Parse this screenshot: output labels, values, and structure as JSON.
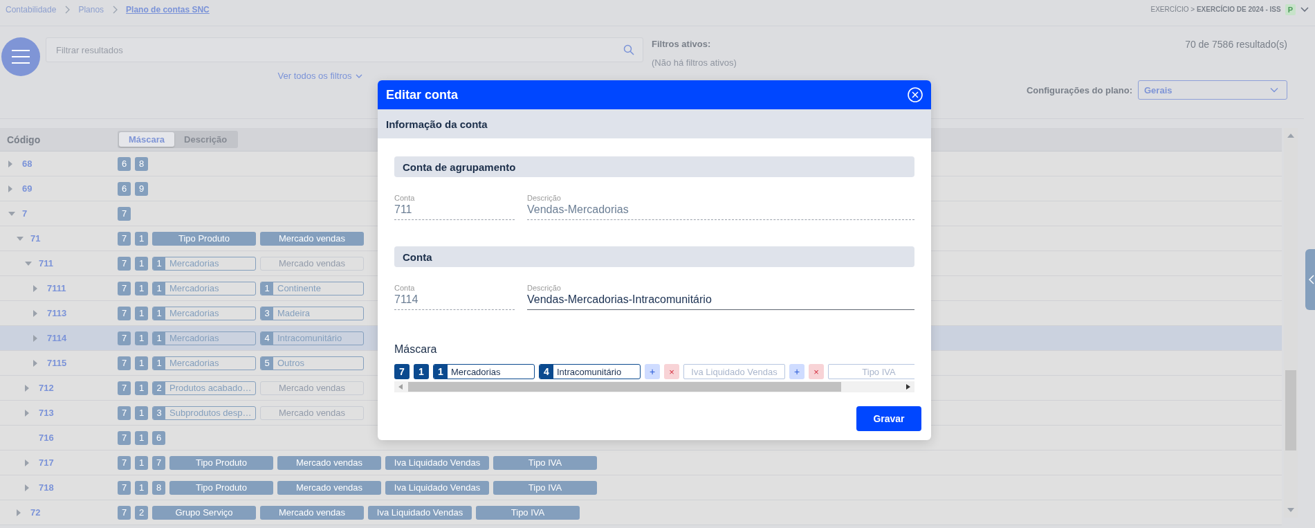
{
  "breadcrumbs": [
    {
      "label": "Contabilidade",
      "current": false
    },
    {
      "label": "Planos",
      "current": false
    },
    {
      "label": "Plano de contas SNC",
      "current": true
    }
  ],
  "exercise": {
    "text": "EXERCÍCIO > **EXERCÍCIO DE 2024 - ISS**",
    "badge": "P"
  },
  "filter": {
    "placeholder": "Filtrar resultados",
    "more_link": "Ver todos os filtros"
  },
  "active_filters": {
    "title": "Filtros ativos:",
    "empty_text": "(Não há filtros ativos)"
  },
  "results_count": "70 de 7586 resultado(s)",
  "plan_config": {
    "label": "Configurações do plano:",
    "value": "Gerais"
  },
  "table": {
    "columns": [
      {
        "label": "Código"
      }
    ],
    "view_toggle": [
      {
        "label": "Máscara",
        "selected": true
      },
      {
        "label": "Descrição",
        "selected": false
      }
    ],
    "rows": [
      {
        "code": "68",
        "expandable": true,
        "expanded": false,
        "selected": false,
        "mask": [
          {
            "kind": "digit",
            "text": "6"
          },
          {
            "kind": "digit",
            "text": "8"
          }
        ]
      },
      {
        "code": "69",
        "expandable": true,
        "expanded": false,
        "selected": false,
        "mask": [
          {
            "kind": "digit",
            "text": "6"
          },
          {
            "kind": "digit",
            "text": "9"
          }
        ]
      },
      {
        "code": "7",
        "expandable": true,
        "expanded": true,
        "selected": false,
        "mask": [
          {
            "kind": "digit",
            "text": "7"
          }
        ],
        "children": [
          {
            "code": "71",
            "expandable": true,
            "expanded": true,
            "selected": false,
            "mask": [
              {
                "kind": "digit",
                "text": "7"
              },
              {
                "kind": "digit",
                "text": "1"
              },
              {
                "kind": "label",
                "text": "Tipo Produto"
              },
              {
                "kind": "label",
                "text": "Mercado vendas"
              }
            ],
            "children": [
              {
                "code": "711",
                "expandable": true,
                "expanded": true,
                "selected": false,
                "mask": [
                  {
                    "kind": "digit",
                    "text": "7"
                  },
                  {
                    "kind": "digit",
                    "text": "1"
                  },
                  {
                    "kind": "value",
                    "prefix": "1",
                    "text": "Mercadorias"
                  },
                  {
                    "kind": "empty",
                    "text": "Mercado vendas"
                  }
                ],
                "children": [
                  {
                    "code": "7111",
                    "expandable": true,
                    "expanded": false,
                    "selected": false,
                    "mask": [
                      {
                        "kind": "digit",
                        "text": "7"
                      },
                      {
                        "kind": "digit",
                        "text": "1"
                      },
                      {
                        "kind": "value",
                        "prefix": "1",
                        "text": "Mercadorias"
                      },
                      {
                        "kind": "value",
                        "prefix": "1",
                        "text": "Continente"
                      }
                    ]
                  },
                  {
                    "code": "7113",
                    "expandable": true,
                    "expanded": false,
                    "selected": false,
                    "mask": [
                      {
                        "kind": "digit",
                        "text": "7"
                      },
                      {
                        "kind": "digit",
                        "text": "1"
                      },
                      {
                        "kind": "value",
                        "prefix": "1",
                        "text": "Mercadorias"
                      },
                      {
                        "kind": "value",
                        "prefix": "3",
                        "text": "Madeira"
                      }
                    ]
                  },
                  {
                    "code": "7114",
                    "expandable": true,
                    "expanded": false,
                    "selected": true,
                    "mask": [
                      {
                        "kind": "digit",
                        "text": "7"
                      },
                      {
                        "kind": "digit",
                        "text": "1"
                      },
                      {
                        "kind": "value",
                        "prefix": "1",
                        "text": "Mercadorias"
                      },
                      {
                        "kind": "value",
                        "prefix": "4",
                        "text": "Intracomunitário"
                      }
                    ]
                  },
                  {
                    "code": "7115",
                    "expandable": true,
                    "expanded": false,
                    "selected": false,
                    "mask": [
                      {
                        "kind": "digit",
                        "text": "7"
                      },
                      {
                        "kind": "digit",
                        "text": "1"
                      },
                      {
                        "kind": "value",
                        "prefix": "1",
                        "text": "Mercadorias"
                      },
                      {
                        "kind": "value",
                        "prefix": "5",
                        "text": "Outros"
                      }
                    ]
                  }
                ]
              },
              {
                "code": "712",
                "expandable": true,
                "expanded": false,
                "selected": false,
                "mask": [
                  {
                    "kind": "digit",
                    "text": "7"
                  },
                  {
                    "kind": "digit",
                    "text": "1"
                  },
                  {
                    "kind": "value",
                    "prefix": "2",
                    "text": "Produtos acabado…"
                  },
                  {
                    "kind": "empty",
                    "text": "Mercado vendas"
                  }
                ]
              },
              {
                "code": "713",
                "expandable": true,
                "expanded": false,
                "selected": false,
                "mask": [
                  {
                    "kind": "digit",
                    "text": "7"
                  },
                  {
                    "kind": "digit",
                    "text": "1"
                  },
                  {
                    "kind": "value",
                    "prefix": "3",
                    "text": "Subprodutos desp…"
                  },
                  {
                    "kind": "empty",
                    "text": "Mercado vendas"
                  }
                ]
              },
              {
                "code": "716",
                "expandable": false,
                "selected": false,
                "mask": [
                  {
                    "kind": "digit",
                    "text": "7"
                  },
                  {
                    "kind": "digit",
                    "text": "1"
                  },
                  {
                    "kind": "digit",
                    "text": "6"
                  }
                ]
              },
              {
                "code": "717",
                "expandable": true,
                "expanded": false,
                "selected": false,
                "mask": [
                  {
                    "kind": "digit",
                    "text": "7"
                  },
                  {
                    "kind": "digit",
                    "text": "1"
                  },
                  {
                    "kind": "digit",
                    "text": "7"
                  },
                  {
                    "kind": "label",
                    "text": "Tipo Produto"
                  },
                  {
                    "kind": "label",
                    "text": "Mercado vendas"
                  },
                  {
                    "kind": "label",
                    "text": "Iva Liquidado Vendas"
                  },
                  {
                    "kind": "label",
                    "text": "Tipo IVA"
                  }
                ]
              },
              {
                "code": "718",
                "expandable": true,
                "expanded": false,
                "selected": false,
                "mask": [
                  {
                    "kind": "digit",
                    "text": "7"
                  },
                  {
                    "kind": "digit",
                    "text": "1"
                  },
                  {
                    "kind": "digit",
                    "text": "8"
                  },
                  {
                    "kind": "label",
                    "text": "Tipo Produto"
                  },
                  {
                    "kind": "label",
                    "text": "Mercado vendas"
                  },
                  {
                    "kind": "label",
                    "text": "Iva Liquidado Vendas"
                  },
                  {
                    "kind": "label",
                    "text": "Tipo IVA"
                  }
                ]
              }
            ]
          },
          {
            "code": "72",
            "expandable": true,
            "expanded": false,
            "selected": false,
            "mask": [
              {
                "kind": "digit",
                "text": "7"
              },
              {
                "kind": "digit",
                "text": "2"
              },
              {
                "kind": "label",
                "text": "Grupo Serviço"
              },
              {
                "kind": "label",
                "text": "Mercado vendas"
              },
              {
                "kind": "label",
                "text": "Iva Liquidado Vendas"
              },
              {
                "kind": "label",
                "text": "Tipo IVA"
              }
            ]
          }
        ]
      }
    ]
  },
  "modal": {
    "title": "Editar conta",
    "section": "Informação da conta",
    "groups": [
      {
        "title": "Conta de agrupamento",
        "fields": [
          {
            "label": "Conta",
            "value": "711",
            "editable": false
          },
          {
            "label": "Descrição",
            "value": "Vendas-Mercadorias",
            "editable": false
          }
        ]
      },
      {
        "title": "Conta",
        "fields": [
          {
            "label": "Conta",
            "value": "7114",
            "editable": false
          },
          {
            "label": "Descrição",
            "value": "Vendas-Mercadorias-Intracomunitário",
            "editable": true
          }
        ]
      }
    ],
    "mask_label": "Máscara",
    "mask": [
      {
        "kind": "digit",
        "text": "7"
      },
      {
        "kind": "digit",
        "text": "1"
      },
      {
        "kind": "value",
        "prefix": "1",
        "text": "Mercadorias"
      },
      {
        "kind": "value",
        "prefix": "4",
        "text": "Intracomunitário"
      },
      {
        "kind": "add",
        "text": "+"
      },
      {
        "kind": "remove",
        "text": "×"
      },
      {
        "kind": "empty",
        "text": "Iva Liquidado Vendas"
      },
      {
        "kind": "add",
        "text": "+"
      },
      {
        "kind": "remove",
        "text": "×"
      },
      {
        "kind": "empty",
        "text": "Tipo IVA"
      }
    ],
    "save_button": "Gravar"
  }
}
